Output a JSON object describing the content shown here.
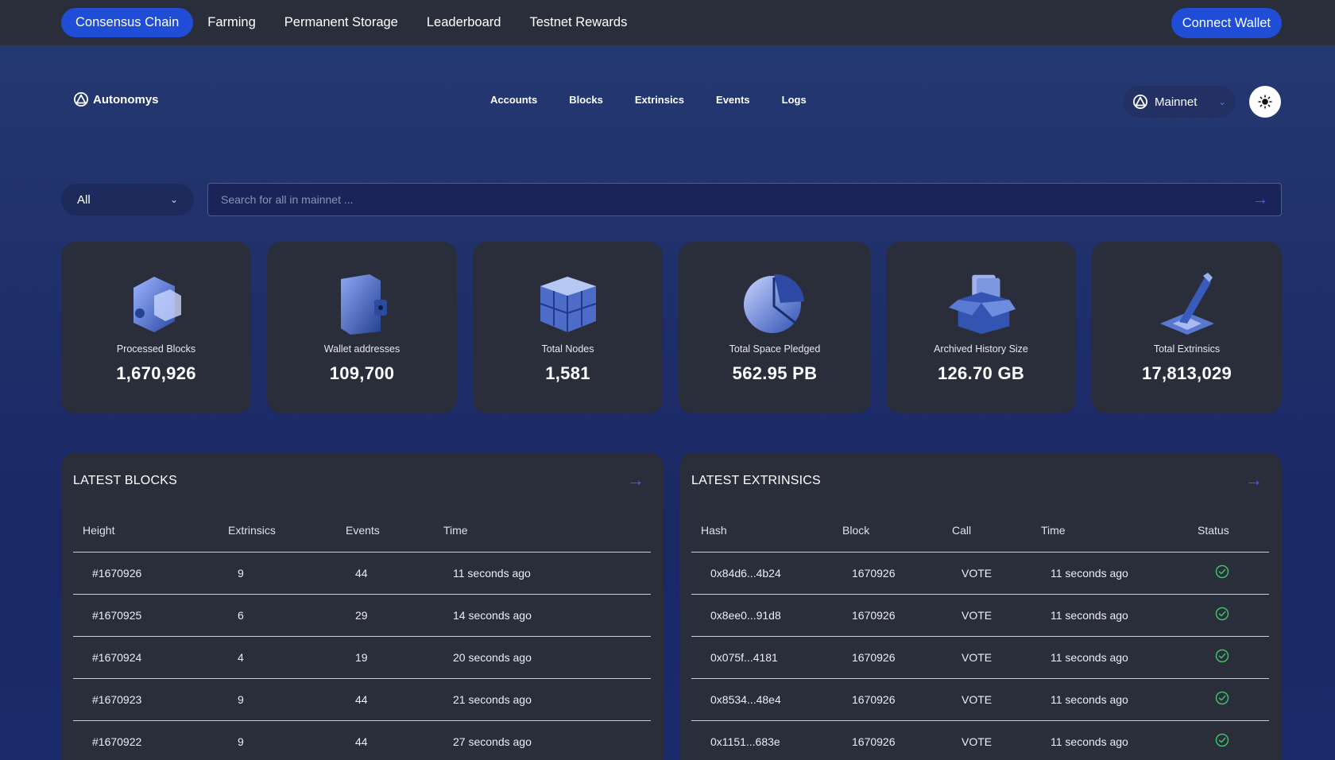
{
  "topnav": {
    "items": [
      "Consensus Chain",
      "Farming",
      "Permanent Storage",
      "Leaderboard",
      "Testnet Rewards"
    ],
    "active": "Consensus Chain",
    "connect_label": "Connect Wallet"
  },
  "header": {
    "brand": "Autonomys",
    "links": [
      "Accounts",
      "Blocks",
      "Extrinsics",
      "Events",
      "Logs"
    ],
    "network": "Mainnet"
  },
  "search": {
    "filter": "All",
    "placeholder": "Search for all in mainnet ..."
  },
  "stats": [
    {
      "label": "Processed Blocks",
      "value": "1,670,926",
      "icon": "block-icon"
    },
    {
      "label": "Wallet addresses",
      "value": "109,700",
      "icon": "wallet-icon"
    },
    {
      "label": "Total Nodes",
      "value": "1,581",
      "icon": "nodes-cube-icon"
    },
    {
      "label": "Total Space Pledged",
      "value": "562.95 PB",
      "icon": "pie-icon"
    },
    {
      "label": "Archived History Size",
      "value": "126.70 GB",
      "icon": "archive-box-icon"
    },
    {
      "label": "Total Extrinsics",
      "value": "17,813,029",
      "icon": "pen-icon"
    }
  ],
  "blocks": {
    "title": "LATEST BLOCKS",
    "headers": [
      "Height",
      "Extrinsics",
      "Events",
      "Time"
    ],
    "rows": [
      [
        "#1670926",
        "9",
        "44",
        "11 seconds ago"
      ],
      [
        "#1670925",
        "6",
        "29",
        "14 seconds ago"
      ],
      [
        "#1670924",
        "4",
        "19",
        "20 seconds ago"
      ],
      [
        "#1670923",
        "9",
        "44",
        "21 seconds ago"
      ],
      [
        "#1670922",
        "9",
        "44",
        "27 seconds ago"
      ]
    ]
  },
  "extrinsics": {
    "title": "LATEST EXTRINSICS",
    "headers": [
      "Hash",
      "Block",
      "Call",
      "Time",
      "Status"
    ],
    "rows": [
      [
        "0x84d6...4b24",
        "1670926",
        "VOTE",
        "11 seconds ago",
        "success"
      ],
      [
        "0x8ee0...91d8",
        "1670926",
        "VOTE",
        "11 seconds ago",
        "success"
      ],
      [
        "0x075f...4181",
        "1670926",
        "VOTE",
        "11 seconds ago",
        "success"
      ],
      [
        "0x8534...48e4",
        "1670926",
        "VOTE",
        "11 seconds ago",
        "success"
      ],
      [
        "0x1151...683e",
        "1670926",
        "VOTE",
        "11 seconds ago",
        "success"
      ]
    ]
  },
  "colors": {
    "accent": "#1f4dd6",
    "panel": "#2a2d3a",
    "success": "#3fbf6a"
  }
}
